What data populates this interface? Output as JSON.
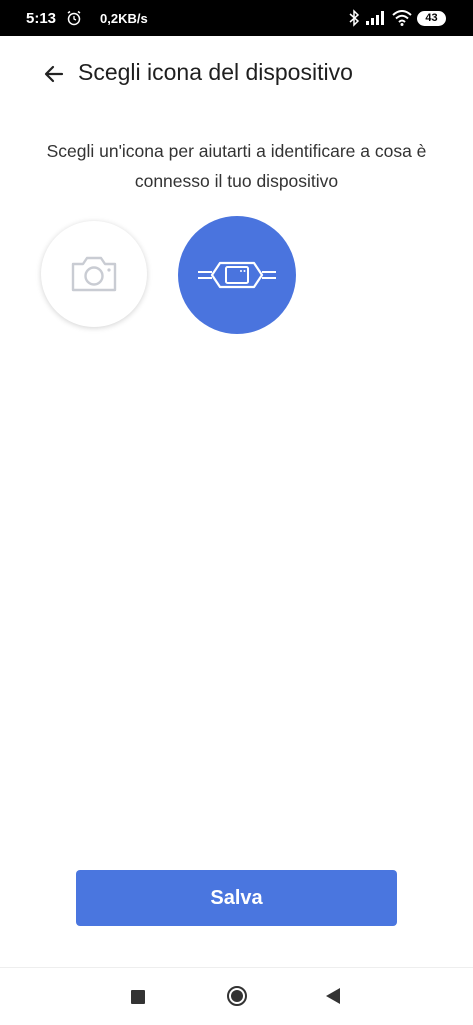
{
  "status_bar": {
    "time": "5:13",
    "net_speed": "0,2KB/s",
    "battery": "43",
    "icons": [
      "alarm-icon",
      "bluetooth-icon",
      "signal-icon",
      "wifi-icon",
      "battery-icon"
    ]
  },
  "header": {
    "title": "Scegli icona del dispositivo",
    "back_icon": "arrow-left-icon"
  },
  "instruction": "Scegli un'icona per aiutarti a identificare a cosa è connesso il tuo dispositivo",
  "icon_choices": [
    {
      "icon": "camera-icon",
      "selected": false
    },
    {
      "icon": "smart-switch-module-icon",
      "selected": true
    }
  ],
  "colors": {
    "accent": "#4a76df",
    "selected_bg": "#4a74de",
    "unselected_icon": "#c9ccd3"
  },
  "save_button": {
    "label": "Salva"
  },
  "nav_bar": {
    "icons": [
      "recents-square-icon",
      "home-circle-icon",
      "back-triangle-icon"
    ]
  }
}
